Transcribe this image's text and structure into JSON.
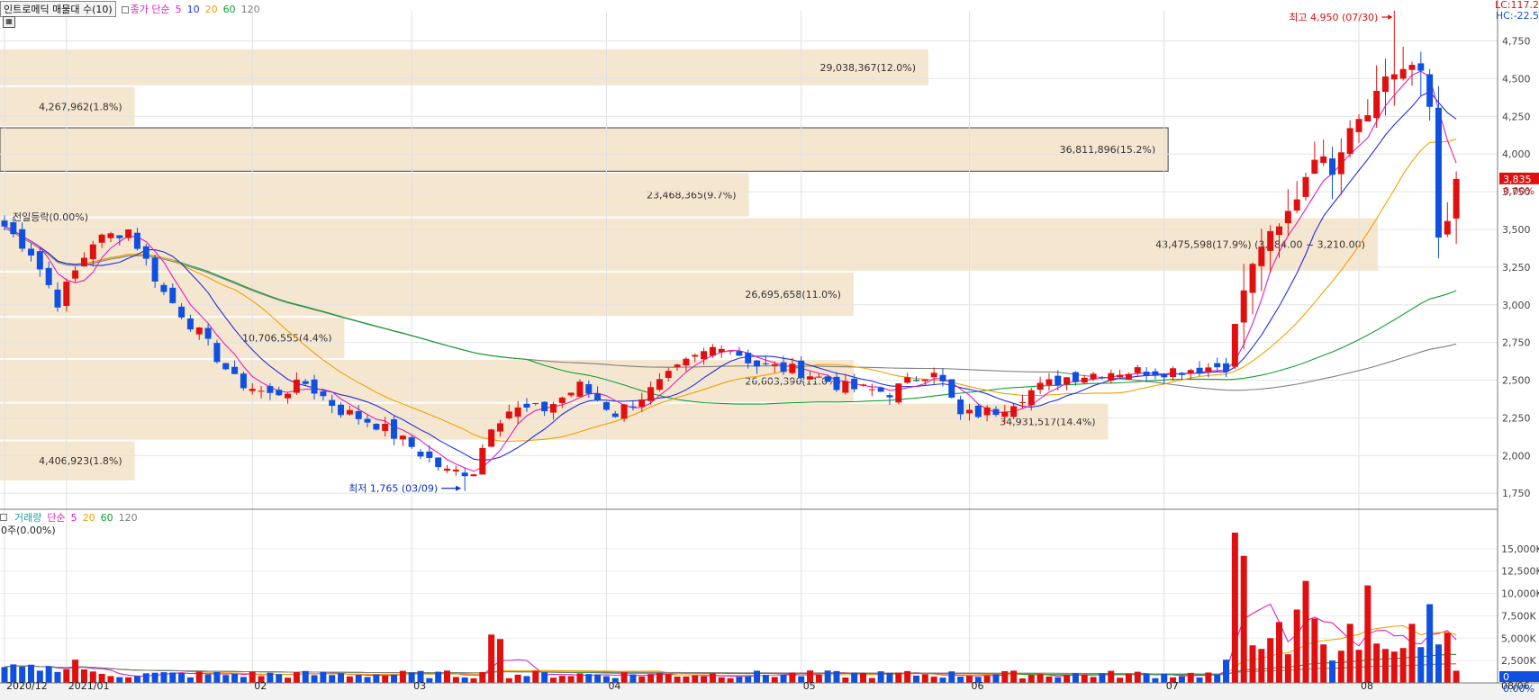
{
  "price_legend": {
    "title": "인트로메딕 매물대 수(10)",
    "ma_label": "종가 단순",
    "periods": [
      "5",
      "10",
      "20",
      "60",
      "120"
    ]
  },
  "volume_legend": {
    "title": "거래량",
    "ma_label": "단순",
    "periods": [
      "5",
      "20",
      "60",
      "120"
    ],
    "value": "0주(0.00%)"
  },
  "corner": {
    "lc": "LC:117.2",
    "hc": "HC:-22.5"
  },
  "current_price": "3,835",
  "current_pct": "0.00%",
  "vol_current": "0",
  "vol_pct": "0.00%",
  "ma_colors": {
    "ma5": "#e020c0",
    "ma10": "#2030e0",
    "ma20": "#f0a000",
    "ma60": "#10a030",
    "ma120": "#808080"
  },
  "up_color": "#e01010",
  "down_color": "#1050e0",
  "chart_data": {
    "type": "candlestick",
    "title": "인트로메딕 매물대 수(10)",
    "x_labels": [
      "2020/12",
      "2021/01",
      "02",
      "03",
      "04",
      "05",
      "06",
      "07",
      "08",
      "08/06"
    ],
    "y_ticks": [
      "4,750",
      "4,500",
      "4,250",
      "4,000",
      "3,750",
      "3,500",
      "3,250",
      "3,000",
      "2,750",
      "2,500",
      "2,250",
      "2,000",
      "1,750"
    ],
    "ylim": [
      1650,
      4950
    ],
    "volume_ticks": [
      "15,000K",
      "12,500K",
      "10,000K",
      "7,500K",
      "5,000K",
      "2,500K"
    ],
    "volume_ylim": [
      0,
      18000
    ],
    "high_label": "최고 4,950 (07/30)",
    "low_label": "최저 1,765 (03/09)",
    "prev_label": "전일등락(0.00%)",
    "volume_profile": [
      {
        "label": "29,038,367(12.0%)",
        "lo": 4450,
        "hi": 4700,
        "len": 0.62
      },
      {
        "label": "4,267,962(1.8%)",
        "lo": 4180,
        "hi": 4450,
        "len": 0.09
      },
      {
        "label": "36,811,896(15.2%)",
        "lo": 3880,
        "hi": 4180,
        "len": 0.78
      },
      {
        "label": "23,468,365(9.7%)",
        "lo": 3580,
        "hi": 3880,
        "len": 0.5
      },
      {
        "label": "43,475,598(17.9%) (3,484.00 ~ 3,210.00)",
        "lo": 3220,
        "hi": 3580,
        "len": 0.92
      },
      {
        "label": "26,695,658(11.0%)",
        "lo": 2920,
        "hi": 3220,
        "len": 0.57
      },
      {
        "label": "10,706,555(4.4%)",
        "lo": 2640,
        "hi": 2920,
        "len": 0.23
      },
      {
        "label": "26,603,396(11.0%)",
        "lo": 2350,
        "hi": 2640,
        "len": 0.57
      },
      {
        "label": "34,931,517(14.4%)",
        "lo": 2100,
        "hi": 2350,
        "len": 0.74
      },
      {
        "label": "4,406,923(1.8%)",
        "lo": 1830,
        "hi": 2100,
        "len": 0.09
      }
    ],
    "ohlc_anchors": [
      {
        "d": 0,
        "c": 3520
      },
      {
        "d": 3,
        "c": 3350
      },
      {
        "d": 6,
        "c": 3020
      },
      {
        "d": 10,
        "c": 3420
      },
      {
        "d": 14,
        "c": 3500
      },
      {
        "d": 18,
        "c": 3080
      },
      {
        "d": 22,
        "c": 2810
      },
      {
        "d": 26,
        "c": 2500
      },
      {
        "d": 30,
        "c": 2400
      },
      {
        "d": 34,
        "c": 2480
      },
      {
        "d": 38,
        "c": 2300
      },
      {
        "d": 42,
        "c": 2210
      },
      {
        "d": 46,
        "c": 2060
      },
      {
        "d": 50,
        "c": 1890
      },
      {
        "d": 53,
        "c": 1900
      },
      {
        "d": 55,
        "c": 2210
      },
      {
        "d": 57,
        "c": 2300
      },
      {
        "d": 61,
        "c": 2310
      },
      {
        "d": 65,
        "c": 2460
      },
      {
        "d": 69,
        "c": 2280
      },
      {
        "d": 73,
        "c": 2430
      },
      {
        "d": 77,
        "c": 2610
      },
      {
        "d": 81,
        "c": 2750
      },
      {
        "d": 85,
        "c": 2600
      },
      {
        "d": 90,
        "c": 2560
      },
      {
        "d": 95,
        "c": 2450
      },
      {
        "d": 100,
        "c": 2420
      },
      {
        "d": 105,
        "c": 2580
      },
      {
        "d": 108,
        "c": 2260
      },
      {
        "d": 112,
        "c": 2300
      },
      {
        "d": 116,
        "c": 2430
      },
      {
        "d": 120,
        "c": 2520
      },
      {
        "d": 125,
        "c": 2560
      },
      {
        "d": 130,
        "c": 2560
      },
      {
        "d": 135,
        "c": 2580
      },
      {
        "d": 138,
        "c": 2600
      },
      {
        "d": 140,
        "c": 3100
      },
      {
        "d": 142,
        "c": 3400
      },
      {
        "d": 144,
        "c": 3500
      },
      {
        "d": 146,
        "c": 3720
      },
      {
        "d": 148,
        "c": 4000
      },
      {
        "d": 150,
        "c": 3900
      },
      {
        "d": 152,
        "c": 4200
      },
      {
        "d": 154,
        "c": 4300
      },
      {
        "d": 156,
        "c": 4520
      },
      {
        "d": 158,
        "c": 4560
      },
      {
        "d": 160,
        "c": 4550
      },
      {
        "d": 161,
        "c": 4320
      },
      {
        "d": 162,
        "c": 3480
      },
      {
        "d": 163,
        "c": 3520
      },
      {
        "d": 164,
        "c": 3835
      }
    ],
    "volume_spikes": [
      {
        "d": 55,
        "v": 5400
      },
      {
        "d": 56,
        "v": 4900
      },
      {
        "d": 138,
        "v": 2600
      },
      {
        "d": 139,
        "v": 16800
      },
      {
        "d": 140,
        "v": 14200
      },
      {
        "d": 141,
        "v": 4200
      },
      {
        "d": 142,
        "v": 3800
      },
      {
        "d": 143,
        "v": 5000
      },
      {
        "d": 144,
        "v": 6800
      },
      {
        "d": 145,
        "v": 3200
      },
      {
        "d": 146,
        "v": 8200
      },
      {
        "d": 147,
        "v": 11400
      },
      {
        "d": 148,
        "v": 7200
      },
      {
        "d": 149,
        "v": 4300
      },
      {
        "d": 150,
        "v": 2500
      },
      {
        "d": 151,
        "v": 3600
      },
      {
        "d": 152,
        "v": 6600
      },
      {
        "d": 153,
        "v": 3700
      },
      {
        "d": 154,
        "v": 10900
      },
      {
        "d": 155,
        "v": 4400
      },
      {
        "d": 156,
        "v": 3800
      },
      {
        "d": 157,
        "v": 3500
      },
      {
        "d": 158,
        "v": 3900
      },
      {
        "d": 159,
        "v": 6600
      },
      {
        "d": 160,
        "v": 4000
      },
      {
        "d": 161,
        "v": 8800
      },
      {
        "d": 162,
        "v": 4300
      },
      {
        "d": 163,
        "v": 5600
      }
    ]
  }
}
